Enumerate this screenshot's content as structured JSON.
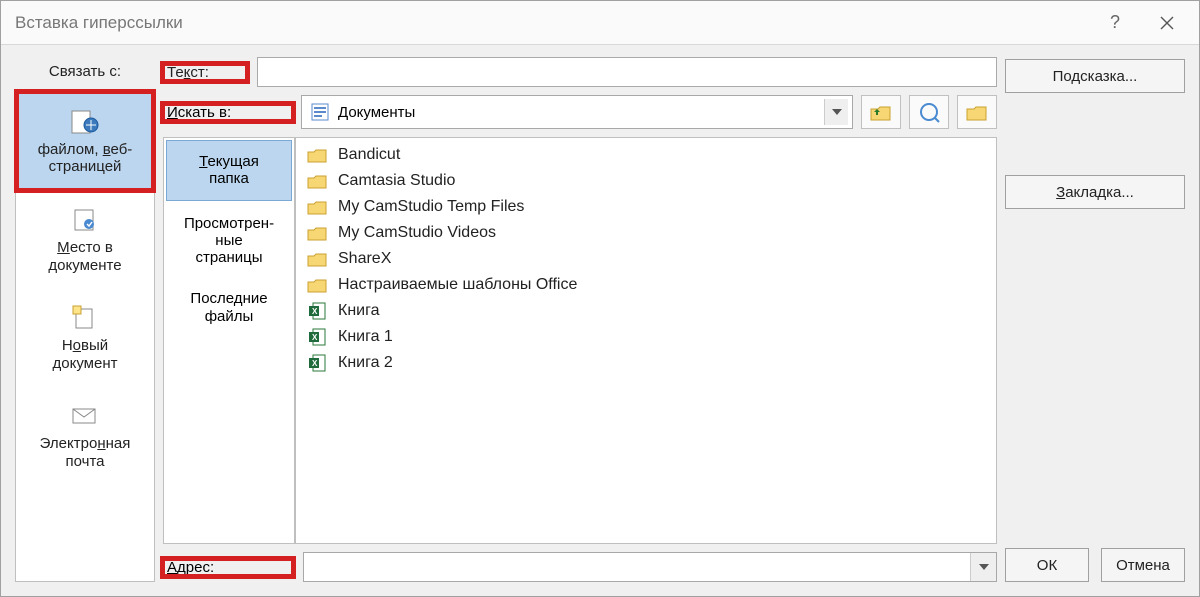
{
  "title": "Вставка гиперссылки",
  "link_to_label": "Связать с:",
  "link_targets": [
    {
      "label": "файлом, веб-страницей",
      "selected": true,
      "icon": "file-web"
    },
    {
      "label": "Место в документе",
      "selected": false,
      "icon": "place-in-doc"
    },
    {
      "label": "Новый документ",
      "selected": false,
      "icon": "new-doc"
    },
    {
      "label": "Электронная почта",
      "selected": false,
      "icon": "email"
    }
  ],
  "text_label": "Текст:",
  "text_value": "",
  "hint_btn": "Подсказка...",
  "lookin_label": "Искать в:",
  "lookin_value": "Документы",
  "browse_tabs": [
    {
      "label": "Текущая папка",
      "selected": true
    },
    {
      "label": "Просмотренные страницы",
      "selected": false
    },
    {
      "label": "Последние файлы",
      "selected": false
    }
  ],
  "files": [
    {
      "name": "Bandicut",
      "type": "folder"
    },
    {
      "name": "Camtasia Studio",
      "type": "folder"
    },
    {
      "name": "My CamStudio Temp Files",
      "type": "folder"
    },
    {
      "name": "My CamStudio Videos",
      "type": "folder"
    },
    {
      "name": "ShareX",
      "type": "folder"
    },
    {
      "name": "Настраиваемые шаблоны Office",
      "type": "folder"
    },
    {
      "name": "Книга",
      "type": "excel"
    },
    {
      "name": "Книга 1",
      "type": "excel"
    },
    {
      "name": "Книга 2",
      "type": "excel"
    }
  ],
  "bookmark_btn": "Закладка...",
  "address_label": "Адрес:",
  "address_value": "",
  "ok_btn": "ОК",
  "cancel_btn": "Отмена"
}
